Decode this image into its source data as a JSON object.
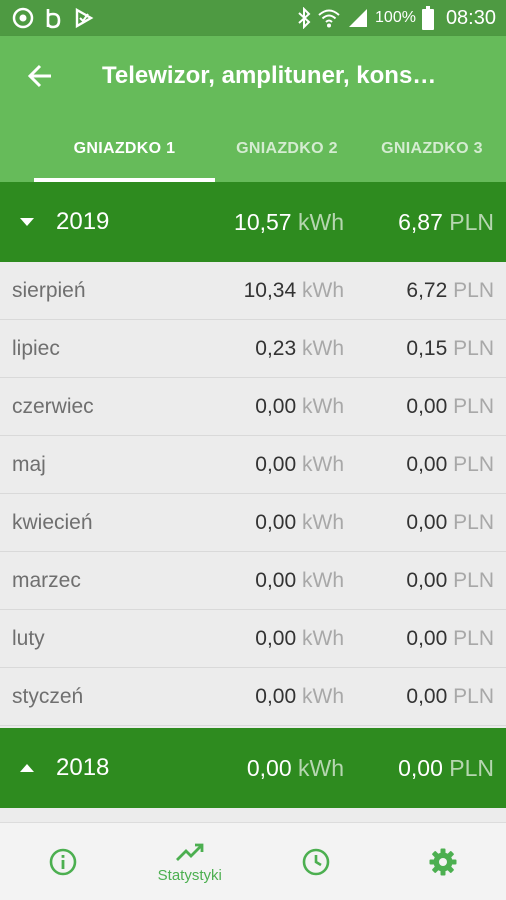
{
  "status_bar": {
    "battery": "100%",
    "time": "08:30"
  },
  "app_bar": {
    "title": "Telewizor, amplituner, kons…"
  },
  "tabs": [
    {
      "label": "GNIAZDKO 1",
      "active": true
    },
    {
      "label": "GNIAZDKO 2",
      "active": false
    },
    {
      "label": "GNIAZDKO 3",
      "active": false
    }
  ],
  "units": {
    "energy": "kWh",
    "currency": "PLN"
  },
  "years": [
    {
      "year": "2019",
      "kwh": "10,57",
      "pln": "6,87",
      "expanded": true,
      "months": [
        {
          "name": "sierpień",
          "kwh": "10,34",
          "pln": "6,72"
        },
        {
          "name": "lipiec",
          "kwh": "0,23",
          "pln": "0,15"
        },
        {
          "name": "czerwiec",
          "kwh": "0,00",
          "pln": "0,00"
        },
        {
          "name": "maj",
          "kwh": "0,00",
          "pln": "0,00"
        },
        {
          "name": "kwiecień",
          "kwh": "0,00",
          "pln": "0,00"
        },
        {
          "name": "marzec",
          "kwh": "0,00",
          "pln": "0,00"
        },
        {
          "name": "luty",
          "kwh": "0,00",
          "pln": "0,00"
        },
        {
          "name": "styczeń",
          "kwh": "0,00",
          "pln": "0,00"
        }
      ]
    },
    {
      "year": "2018",
      "kwh": "0,00",
      "pln": "0,00",
      "expanded": false
    }
  ],
  "bottom_nav": [
    {
      "icon": "info-icon",
      "label": ""
    },
    {
      "icon": "trending-up-icon",
      "label": "Statystyki"
    },
    {
      "icon": "clock-icon",
      "label": ""
    },
    {
      "icon": "gear-icon",
      "label": ""
    }
  ],
  "colors": {
    "status_bar": "#4e9a42",
    "app_bar": "#66bb5a",
    "year_row": "#2e8b1f",
    "accent": "#4caf50",
    "row_background": "#ececec"
  }
}
